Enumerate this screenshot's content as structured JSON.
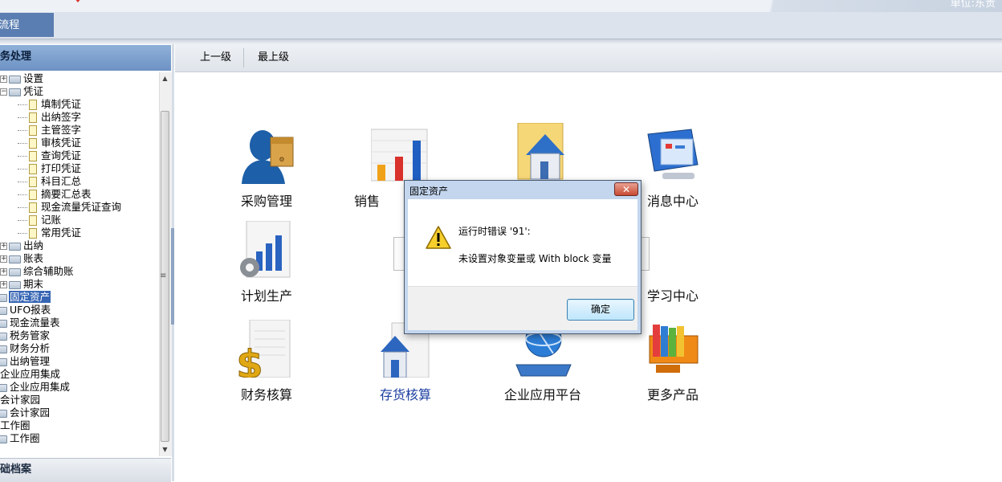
{
  "topbar": {
    "unit_text": "单位:东贵"
  },
  "tab": {
    "active_label": "E流程"
  },
  "left": {
    "header": "务处理",
    "footer": "础档案",
    "tree": [
      {
        "label": "设置",
        "type": "folder",
        "expander": "+"
      },
      {
        "label": "凭证",
        "type": "folder",
        "expander": "−"
      },
      {
        "label": "填制凭证",
        "type": "doc"
      },
      {
        "label": "出纳签字",
        "type": "doc"
      },
      {
        "label": "主管签字",
        "type": "doc"
      },
      {
        "label": "审核凭证",
        "type": "doc"
      },
      {
        "label": "查询凭证",
        "type": "doc"
      },
      {
        "label": "打印凭证",
        "type": "doc"
      },
      {
        "label": "科目汇总",
        "type": "doc"
      },
      {
        "label": "摘要汇总表",
        "type": "doc"
      },
      {
        "label": "现金流量凭证查询",
        "type": "doc"
      },
      {
        "label": "记账",
        "type": "doc"
      },
      {
        "label": "常用凭证",
        "type": "doc"
      },
      {
        "label": "出纳",
        "type": "folder",
        "expander": "+"
      },
      {
        "label": "账表",
        "type": "folder",
        "expander": "+"
      },
      {
        "label": "综合辅助账",
        "type": "folder",
        "expander": "+"
      },
      {
        "label": "期末",
        "type": "folder",
        "expander": "+"
      },
      {
        "label": "固定资产",
        "type": "root",
        "selected": true
      },
      {
        "label": "UFO报表",
        "type": "root"
      },
      {
        "label": "现金流量表",
        "type": "root"
      },
      {
        "label": "税务管家",
        "type": "root"
      },
      {
        "label": "财务分析",
        "type": "root"
      },
      {
        "label": "出纳管理",
        "type": "root"
      },
      {
        "label": "企业应用集成",
        "type": "group"
      },
      {
        "label": "企业应用集成",
        "type": "root"
      },
      {
        "label": "会计家园",
        "type": "group"
      },
      {
        "label": "会计家园",
        "type": "root"
      },
      {
        "label": "工作圈",
        "type": "group"
      },
      {
        "label": "工作圈",
        "type": "root"
      }
    ]
  },
  "toolbar": {
    "up_label": "上一级",
    "top_label": "最上级"
  },
  "modules": {
    "purchase": "采购管理",
    "sales": "销售",
    "message": "消息中心",
    "plan": "计划生产",
    "learn": "学习中心",
    "finance": "财务核算",
    "inventory": "存货核算",
    "platform": "企业应用平台",
    "more": "更多产品"
  },
  "dialog": {
    "title": "固定资产",
    "close_glyph": "✕",
    "message_line1": "运行时错误 '91':",
    "message_line2": "未设置对象变量或 With block 变量",
    "ok_label": "确定"
  },
  "colors": {
    "selection": "#3766b4",
    "panel_header": "#6d92c4",
    "dialog_frame": "#c3d6ee",
    "link_caption": "#1b3ea0"
  },
  "scrollbar": {
    "grip_glyph": "≡",
    "up_glyph": "▲",
    "down_glyph": "▼"
  }
}
